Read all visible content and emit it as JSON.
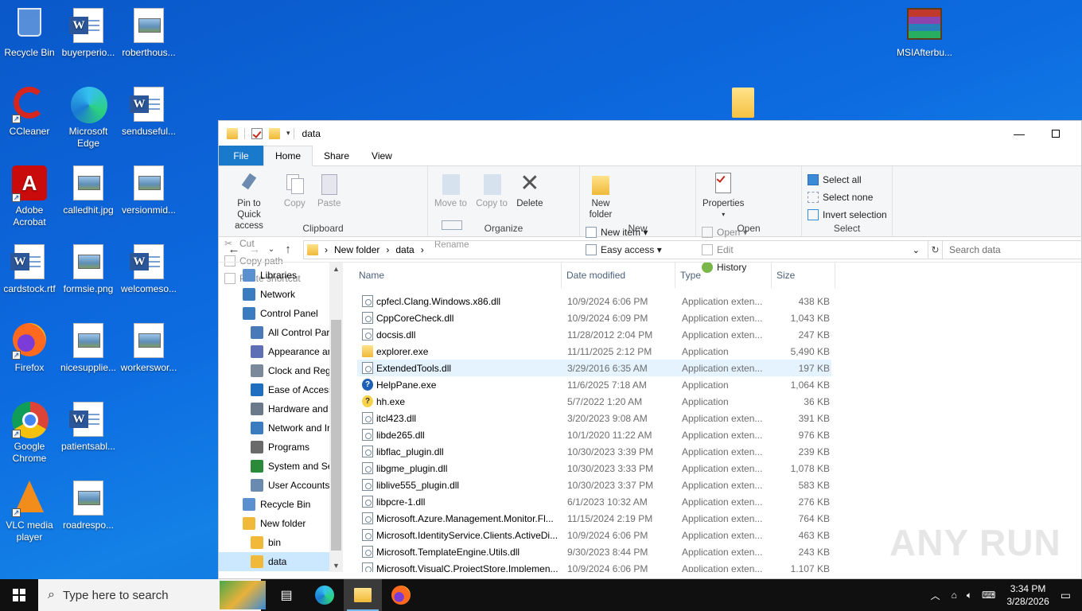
{
  "desktop": {
    "icons": [
      {
        "label": "Recycle Bin"
      },
      {
        "label": "buyerperio..."
      },
      {
        "label": "roberthous..."
      },
      {
        "label": "CCleaner"
      },
      {
        "label": "Microsoft Edge"
      },
      {
        "label": "senduseful..."
      },
      {
        "label": "Adobe Acrobat"
      },
      {
        "label": "calledhit.jpg"
      },
      {
        "label": "versionmid..."
      },
      {
        "label": "cardstock.rtf"
      },
      {
        "label": "formsie.png"
      },
      {
        "label": "welcomeso..."
      },
      {
        "label": "Firefox"
      },
      {
        "label": "nicesupplie..."
      },
      {
        "label": "workerswor..."
      },
      {
        "label": "Google Chrome"
      },
      {
        "label": "patientsabl..."
      },
      {
        "label": "VLC media player"
      },
      {
        "label": "roadrespo..."
      },
      {
        "label": "MSIAfterbu..."
      }
    ]
  },
  "explorer": {
    "title": "data",
    "tabs": [
      "File",
      "Home",
      "Share",
      "View"
    ],
    "ribbon": {
      "clipboard": {
        "label": "Clipboard",
        "pin": "Pin to Quick access",
        "copy": "Copy",
        "paste": "Paste",
        "cut": "Cut",
        "copy_path": "Copy path",
        "paste_shortcut": "Paste shortcut"
      },
      "organize": {
        "label": "Organize",
        "move_to": "Move to",
        "copy_to": "Copy to",
        "delete": "Delete",
        "rename": "Rename"
      },
      "new": {
        "label": "New",
        "new_folder": "New folder",
        "new_item": "New item",
        "easy_access": "Easy access"
      },
      "open": {
        "label": "Open",
        "properties": "Properties",
        "open": "Open",
        "edit": "Edit",
        "history": "History"
      },
      "select": {
        "label": "Select",
        "select_all": "Select all",
        "select_none": "Select none",
        "invert": "Invert selection"
      }
    },
    "address": {
      "crumbs": [
        "New folder",
        "data"
      ],
      "search_placeholder": "Search data"
    },
    "nav": [
      {
        "label": "Libraries",
        "indent": 0
      },
      {
        "label": "Network",
        "indent": 0
      },
      {
        "label": "Control Panel",
        "indent": 0
      },
      {
        "label": "All Control Par",
        "indent": 1
      },
      {
        "label": "Appearance an",
        "indent": 1
      },
      {
        "label": "Clock and Regi",
        "indent": 1
      },
      {
        "label": "Ease of Access",
        "indent": 1
      },
      {
        "label": "Hardware and",
        "indent": 1
      },
      {
        "label": "Network and Ir",
        "indent": 1
      },
      {
        "label": "Programs",
        "indent": 1
      },
      {
        "label": "System and Sec",
        "indent": 1
      },
      {
        "label": "User Accounts",
        "indent": 1
      },
      {
        "label": "Recycle Bin",
        "indent": 0
      },
      {
        "label": "New folder",
        "indent": 0
      },
      {
        "label": "bin",
        "indent": 1
      },
      {
        "label": "data",
        "indent": 1
      }
    ],
    "columns": {
      "name": "Name",
      "date": "Date modified",
      "type": "Type",
      "size": "Size"
    },
    "files": [
      {
        "name": "cpfecl.Clang.Windows.x86.dll",
        "date": "10/9/2024 6:06 PM",
        "type": "Application exten...",
        "size": "438 KB",
        "icon": "dll"
      },
      {
        "name": "CppCoreCheck.dll",
        "date": "10/9/2024 6:09 PM",
        "type": "Application exten...",
        "size": "1,043 KB",
        "icon": "dll"
      },
      {
        "name": "docsis.dll",
        "date": "11/28/2012 2:04 PM",
        "type": "Application exten...",
        "size": "247 KB",
        "icon": "dll"
      },
      {
        "name": "explorer.exe",
        "date": "11/11/2025 2:12 PM",
        "type": "Application",
        "size": "5,490 KB",
        "icon": "folder"
      },
      {
        "name": "ExtendedTools.dll",
        "date": "3/29/2016 6:35 AM",
        "type": "Application exten...",
        "size": "197 KB",
        "icon": "dll"
      },
      {
        "name": "HelpPane.exe",
        "date": "11/6/2025 7:18 AM",
        "type": "Application",
        "size": "1,064 KB",
        "icon": "help"
      },
      {
        "name": "hh.exe",
        "date": "5/7/2022 1:20 AM",
        "type": "Application",
        "size": "36 KB",
        "icon": "hh"
      },
      {
        "name": "itcl423.dll",
        "date": "3/20/2023 9:08 AM",
        "type": "Application exten...",
        "size": "391 KB",
        "icon": "dll"
      },
      {
        "name": "libde265.dll",
        "date": "10/1/2020 11:22 AM",
        "type": "Application exten...",
        "size": "976 KB",
        "icon": "dll"
      },
      {
        "name": "libflac_plugin.dll",
        "date": "10/30/2023 3:39 PM",
        "type": "Application exten...",
        "size": "239 KB",
        "icon": "dll"
      },
      {
        "name": "libgme_plugin.dll",
        "date": "10/30/2023 3:33 PM",
        "type": "Application exten...",
        "size": "1,078 KB",
        "icon": "dll"
      },
      {
        "name": "liblive555_plugin.dll",
        "date": "10/30/2023 3:37 PM",
        "type": "Application exten...",
        "size": "583 KB",
        "icon": "dll"
      },
      {
        "name": "libpcre-1.dll",
        "date": "6/1/2023 10:32 AM",
        "type": "Application exten...",
        "size": "276 KB",
        "icon": "dll"
      },
      {
        "name": "Microsoft.Azure.Management.Monitor.Fl...",
        "date": "11/15/2024 2:19 PM",
        "type": "Application exten...",
        "size": "764 KB",
        "icon": "dll"
      },
      {
        "name": "Microsoft.IdentityService.Clients.ActiveDi...",
        "date": "10/9/2024 6:06 PM",
        "type": "Application exten...",
        "size": "463 KB",
        "icon": "dll"
      },
      {
        "name": "Microsoft.TemplateEngine.Utils.dll",
        "date": "9/30/2023 8:44 PM",
        "type": "Application exten...",
        "size": "243 KB",
        "icon": "dll"
      },
      {
        "name": "Microsoft.VisualC.ProjectStore.Implemen...",
        "date": "10/9/2024 6:06 PM",
        "type": "Application exten...",
        "size": "1,107 KB",
        "icon": "dll"
      }
    ],
    "highlighted_index": 4
  },
  "watermark": "ANY RUN",
  "taskbar": {
    "search_placeholder": "Type here to search",
    "time": "3:34 PM",
    "date": "3/28/2026"
  },
  "colors": {
    "accent": "#1979ca",
    "selection": "#cce8ff",
    "hover": "#e5f3ff"
  }
}
